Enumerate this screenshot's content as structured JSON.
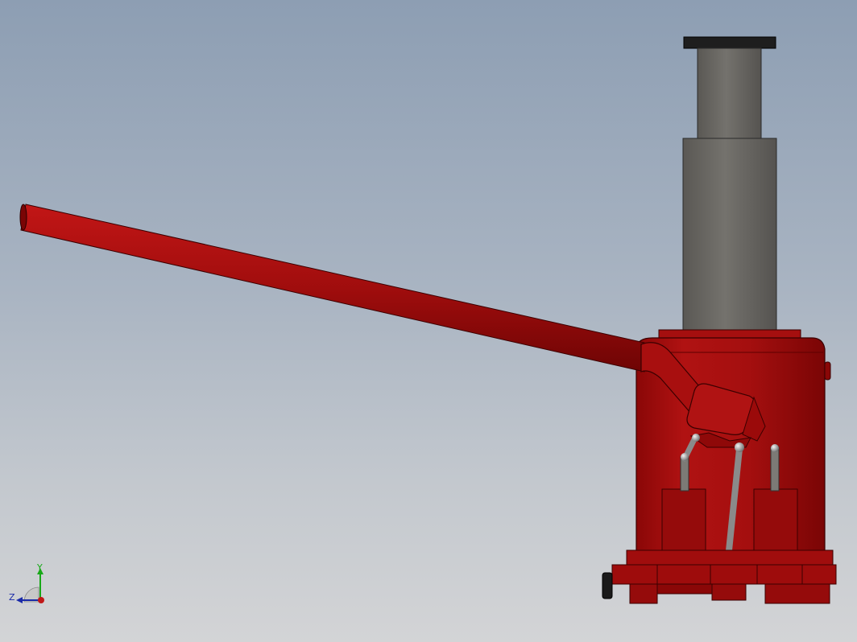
{
  "viewport": {
    "background_top": "#8d9eb3",
    "background_bottom": "#d3d4d6"
  },
  "model": {
    "body_color": "#9b0a0a",
    "ram_color": "#6a6863",
    "cap_color": "#1e1e1e"
  },
  "triad": {
    "y_label": "Y",
    "z_label": "Z",
    "y_color": "#18a818",
    "z_color": "#1a2aa8",
    "x_color": "#c01818"
  }
}
